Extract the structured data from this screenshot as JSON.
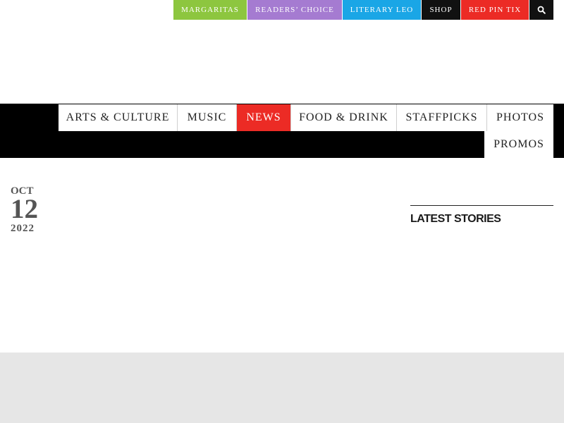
{
  "topbar": {
    "items": [
      {
        "label": "MARGARITAS",
        "color": "#8dc63f"
      },
      {
        "label": "READERS’ CHOICE",
        "color": "#a57bd1"
      },
      {
        "label": "LITERARY LEO",
        "color": "#1aa6e6"
      },
      {
        "label": "SHOP",
        "color": "#111111"
      },
      {
        "label": "RED PIN TIX",
        "color": "#ec2b25"
      }
    ],
    "search_icon": "search-icon",
    "search_color": "#111111"
  },
  "nav": {
    "items": [
      {
        "label": "ARTS & CULTURE"
      },
      {
        "label": "MUSIC"
      },
      {
        "label": "NEWS",
        "active": true
      },
      {
        "label": "FOOD & DRINK"
      },
      {
        "label": "STAFFPICKS"
      },
      {
        "label": "PHOTOS"
      },
      {
        "label": "PROMOS"
      }
    ],
    "active_color": "#ec2b25",
    "bar_color": "#000000"
  },
  "article": {
    "date": {
      "month": "OCT",
      "day": "12",
      "year": "2022"
    }
  },
  "sidebar": {
    "title": "LATEST STORIES"
  },
  "footer": {
    "color": "#e6e6e6"
  }
}
